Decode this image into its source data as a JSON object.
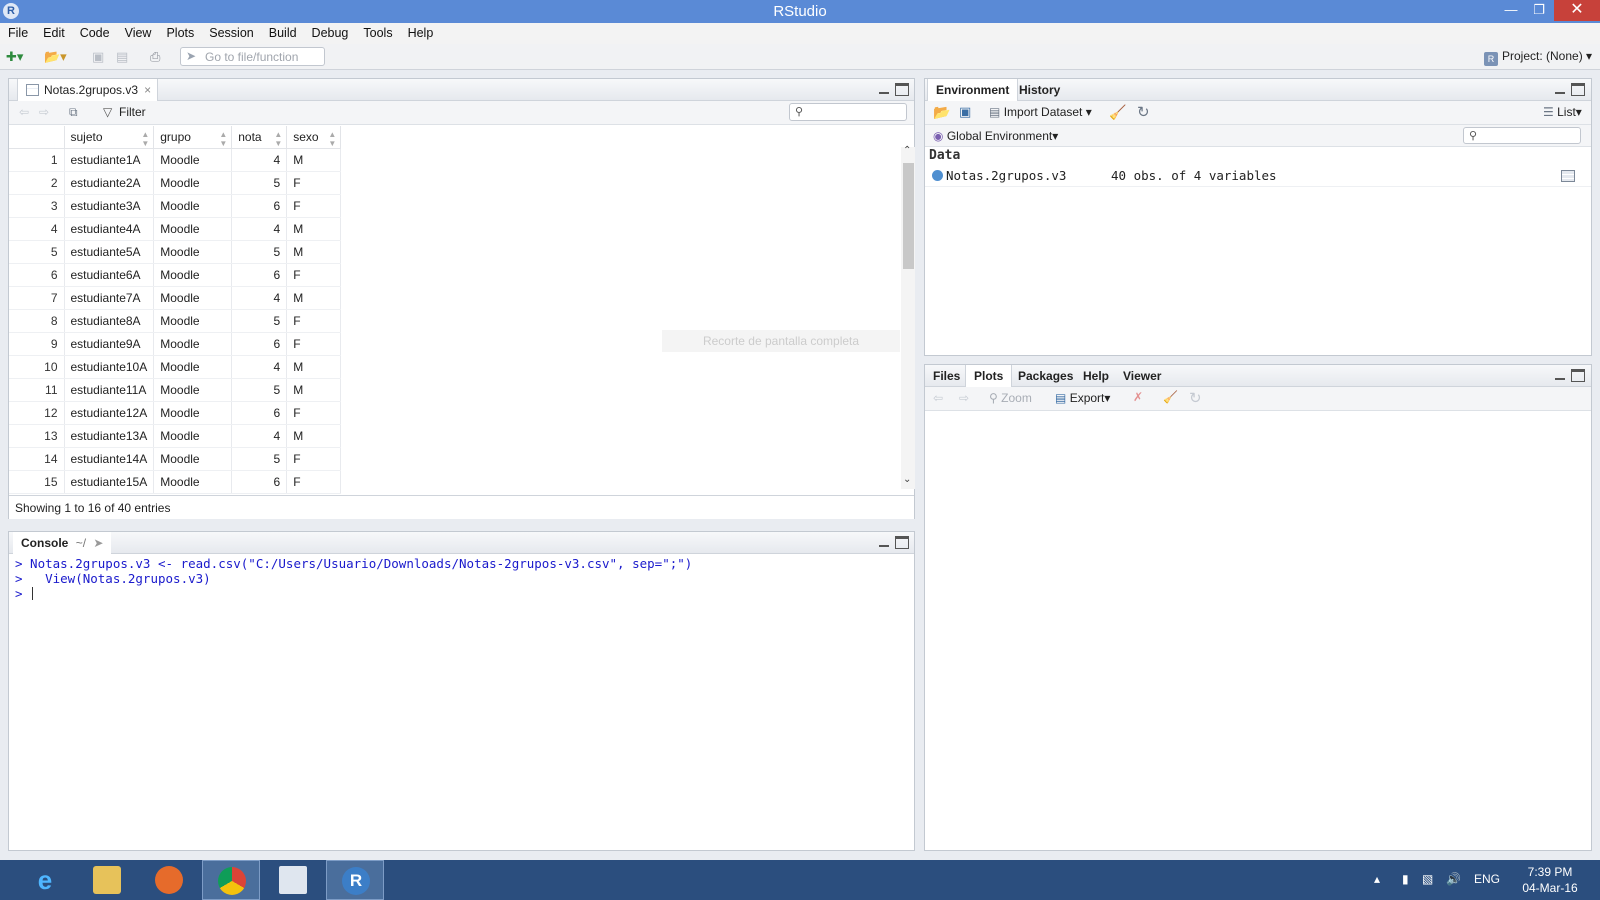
{
  "window": {
    "title": "RStudio"
  },
  "menu": [
    "File",
    "Edit",
    "Code",
    "View",
    "Plots",
    "Session",
    "Build",
    "Debug",
    "Tools",
    "Help"
  ],
  "toolbar": {
    "goto_placeholder": "Go to file/function",
    "project": "Project: (None)"
  },
  "source": {
    "tab_label": "Notas.2grupos.v3",
    "filter_label": "Filter",
    "columns": [
      "",
      "sujeto",
      "grupo",
      "nota",
      "sexo"
    ],
    "rows": [
      [
        "1",
        "estudiante1A",
        "Moodle",
        "4",
        "M"
      ],
      [
        "2",
        "estudiante2A",
        "Moodle",
        "5",
        "F"
      ],
      [
        "3",
        "estudiante3A",
        "Moodle",
        "6",
        "F"
      ],
      [
        "4",
        "estudiante4A",
        "Moodle",
        "4",
        "M"
      ],
      [
        "5",
        "estudiante5A",
        "Moodle",
        "5",
        "M"
      ],
      [
        "6",
        "estudiante6A",
        "Moodle",
        "6",
        "F"
      ],
      [
        "7",
        "estudiante7A",
        "Moodle",
        "4",
        "M"
      ],
      [
        "8",
        "estudiante8A",
        "Moodle",
        "5",
        "F"
      ],
      [
        "9",
        "estudiante9A",
        "Moodle",
        "6",
        "F"
      ],
      [
        "10",
        "estudiante10A",
        "Moodle",
        "4",
        "M"
      ],
      [
        "11",
        "estudiante11A",
        "Moodle",
        "5",
        "M"
      ],
      [
        "12",
        "estudiante12A",
        "Moodle",
        "6",
        "F"
      ],
      [
        "13",
        "estudiante13A",
        "Moodle",
        "4",
        "M"
      ],
      [
        "14",
        "estudiante14A",
        "Moodle",
        "5",
        "F"
      ],
      [
        "15",
        "estudiante15A",
        "Moodle",
        "6",
        "F"
      ]
    ],
    "status": "Showing 1 to 16 of 40 entries",
    "overlay_text": "Recorte de pantalla completa"
  },
  "console": {
    "title": "Console",
    "path": "~/",
    "lines": [
      "> Notas.2grupos.v3 <- read.csv(\"C:/Users/Usuario/Downloads/Notas-2grupos-v3.csv\", sep=\";\")",
      ">   View(Notas.2grupos.v3)",
      "> "
    ]
  },
  "environment": {
    "tabs": [
      "Environment",
      "History"
    ],
    "import_label": "Import Dataset",
    "list_label": "List",
    "scope": "Global Environment",
    "section": "Data",
    "items": [
      {
        "name": "Notas.2grupos.v3",
        "desc": "40 obs. of 4 variables"
      }
    ]
  },
  "files": {
    "tabs": [
      "Files",
      "Plots",
      "Packages",
      "Help",
      "Viewer"
    ],
    "zoom_label": "Zoom",
    "export_label": "Export"
  },
  "taskbar": {
    "lang": "ENG",
    "time": "7:39 PM",
    "date": "04-Mar-16"
  }
}
